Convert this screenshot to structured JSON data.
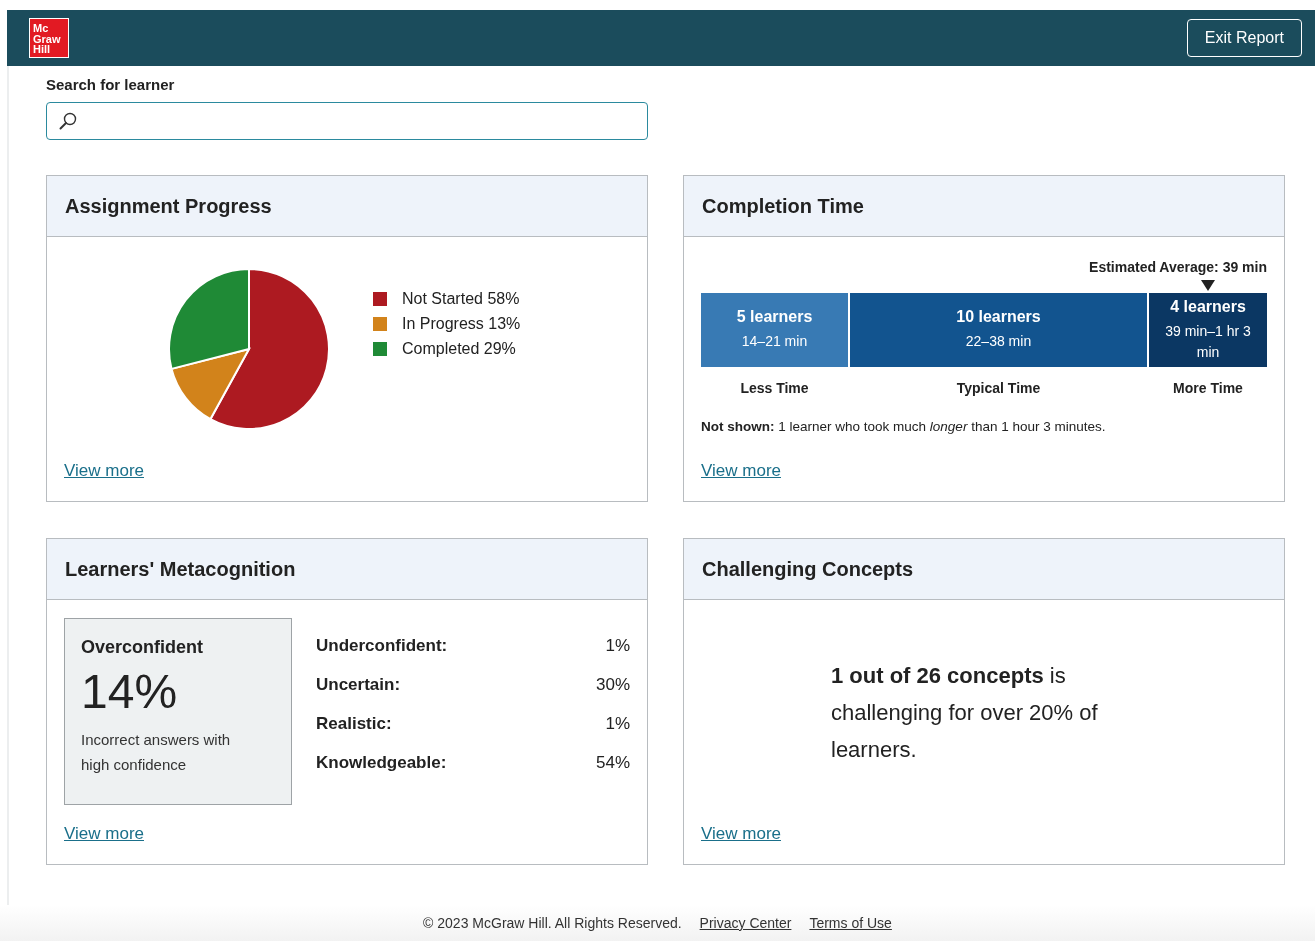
{
  "header": {
    "logo_lines": [
      "Mc",
      "Graw",
      "Hill"
    ],
    "exit_button": "Exit Report"
  },
  "search": {
    "label": "Search for learner"
  },
  "assignment_progress": {
    "title": "Assignment Progress",
    "chart_data": {
      "type": "pie",
      "categories": [
        "Not Started",
        "In Progress",
        "Completed"
      ],
      "values": [
        58,
        13,
        29
      ]
    },
    "legend": [
      {
        "percent": "58%",
        "color": "#ad1a21"
      },
      {
        "percent": "13%",
        "color": "#d2831b"
      },
      {
        "percent": "29%",
        "color": "#1f8a36"
      }
    ],
    "link": "View more"
  },
  "completion_time": {
    "title": "Completion Time",
    "average": "Estimated Average: 39 min",
    "segments": [
      {
        "learners": "5 learners",
        "range": "14–21 min",
        "label": "Less Time",
        "color": "#387ab4",
        "marker": false
      },
      {
        "learners": "10 learners",
        "range": "22–38 min",
        "label": "Typical Time",
        "color": "#12548f",
        "marker": false
      },
      {
        "learners": "4 learners",
        "range": "39 min–1 hr 3 min",
        "label": "More Time",
        "color": "#0b3763",
        "marker": true
      }
    ],
    "note": "**Not shown:** 1 learner who took much *longer* than 1 hour 3 minutes.",
    "link": "View more"
  },
  "metacognition": {
    "title": "Learners' Metacognition",
    "highlight": {
      "label": "Overconfident",
      "value": "14%",
      "description": "Incorrect answers with high confidence"
    },
    "rows": [
      {
        "label": "Underconfident:",
        "value": "1%"
      },
      {
        "label": "Uncertain:",
        "value": "30%"
      },
      {
        "label": "Realistic:",
        "value": "1%"
      },
      {
        "label": "Knowledgeable:",
        "value": "54%"
      }
    ],
    "link": "View more"
  },
  "challenging_concepts": {
    "title": "Challenging Concepts",
    "summary": "**1 out of 26 concepts** is challenging for over 20% of learners.",
    "link": "View more"
  },
  "footer": {
    "copyright": "© 2023 McGraw Hill. All Rights Reserved.",
    "links": [
      "Privacy Center",
      "Terms of Use"
    ]
  }
}
